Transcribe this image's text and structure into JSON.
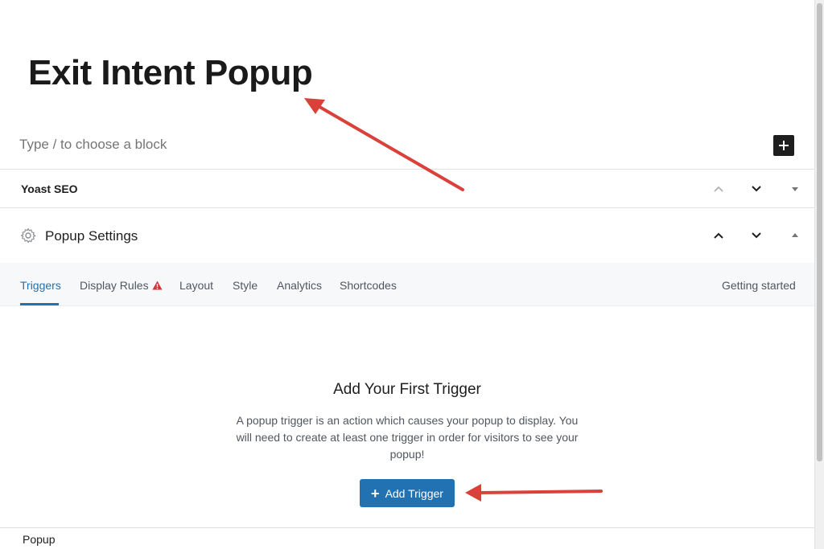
{
  "post": {
    "title": "Exit Intent Popup",
    "block_placeholder": "Type / to choose a block"
  },
  "metaboxes": {
    "yoast": {
      "title": "Yoast SEO"
    },
    "popup_settings": {
      "title": "Popup Settings"
    }
  },
  "tabs": [
    {
      "label": "Triggers",
      "active": true
    },
    {
      "label": "Display Rules",
      "warning": true
    },
    {
      "label": "Layout"
    },
    {
      "label": "Style"
    },
    {
      "label": "Analytics"
    },
    {
      "label": "Shortcodes"
    }
  ],
  "getting_started": "Getting started",
  "empty_state": {
    "title": "Add Your First Trigger",
    "description": "A popup trigger is an action which causes your popup to display. You will need to create at least one trigger in order for visitors to see your popup!",
    "button_label": "Add Trigger"
  },
  "footer": {
    "label": "Popup"
  },
  "colors": {
    "accent": "#2271b1",
    "warning": "#d63638",
    "annotation_arrow": "#d9413a"
  },
  "icons": [
    "plus-icon",
    "chevron-up-icon",
    "chevron-down-icon",
    "caret-down-icon",
    "caret-up-icon",
    "gear-icon",
    "warning-icon"
  ]
}
